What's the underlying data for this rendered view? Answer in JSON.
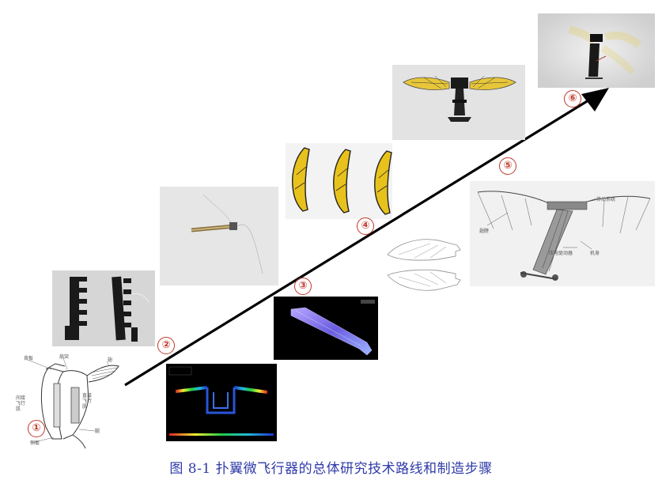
{
  "caption": {
    "figure_no": "图 8-1",
    "title": "扑翼微飞行器的总体研究技术路线和制造步骤"
  },
  "steps": [
    "①",
    "②",
    "③",
    "④",
    "⑤",
    "⑥"
  ],
  "anatomy_labels": {
    "wing": "翅",
    "membrane": "扇突",
    "muscle_left": "间接\n飞行\n肌",
    "muscle_right": "直接\n飞行\n肌",
    "pleura": "侧板",
    "leg": "腿",
    "ridge": "背板"
  },
  "prototype_labels": {
    "transmission": "传动系统",
    "wing": "翅膀",
    "actuator": "压电驱动器",
    "body": "机身"
  },
  "colors": {
    "caption": "#2e3aa8",
    "step_marker": "#c0392b",
    "arrow": "#000000",
    "wing_yellow": "#e8c21c"
  }
}
